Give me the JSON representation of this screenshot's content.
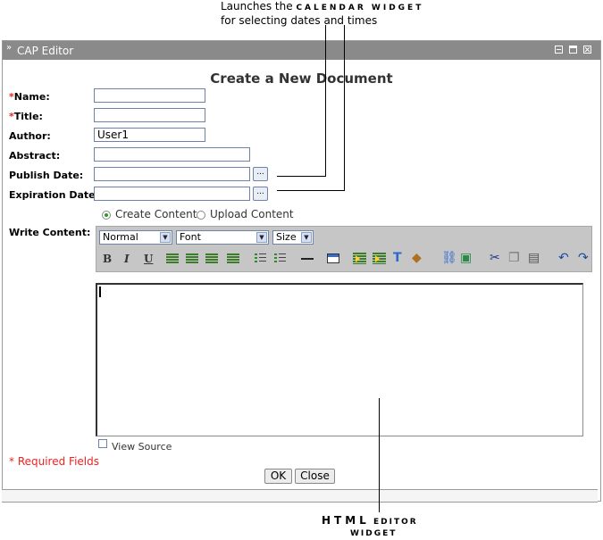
{
  "callouts": {
    "calendar": {
      "prefix": "Launches the",
      "emphasis": "CALENDAR WIDGET",
      "line2": "for selecting dates and times"
    },
    "editor": {
      "word1": "HTML",
      "word2": "EDITOR",
      "word3": "WIDGET"
    }
  },
  "window": {
    "title": "CAP Editor",
    "heading": "Create a New Document"
  },
  "form": {
    "name_label": "Name:",
    "title_label": "Title:",
    "author_label": "Author:",
    "author_value": "User1",
    "abstract_label": "Abstract:",
    "publish_date_label": "Publish Date:",
    "expiration_date_label": "Expiration Date:",
    "picker_label": "...",
    "required_marker": "*",
    "write_content_label": "Write Content:",
    "content_mode": {
      "create_label": "Create Content",
      "upload_label": "Upload Content",
      "selected": "create"
    }
  },
  "toolbar": {
    "format_value": "Normal",
    "font_value": "Font",
    "size_value": "Size",
    "bold": "B",
    "italic": "I",
    "underline": "U"
  },
  "editor": {
    "view_source_label": "View Source"
  },
  "footer": {
    "required_note": "* Required Fields",
    "ok_label": "OK",
    "close_label": "Close"
  }
}
